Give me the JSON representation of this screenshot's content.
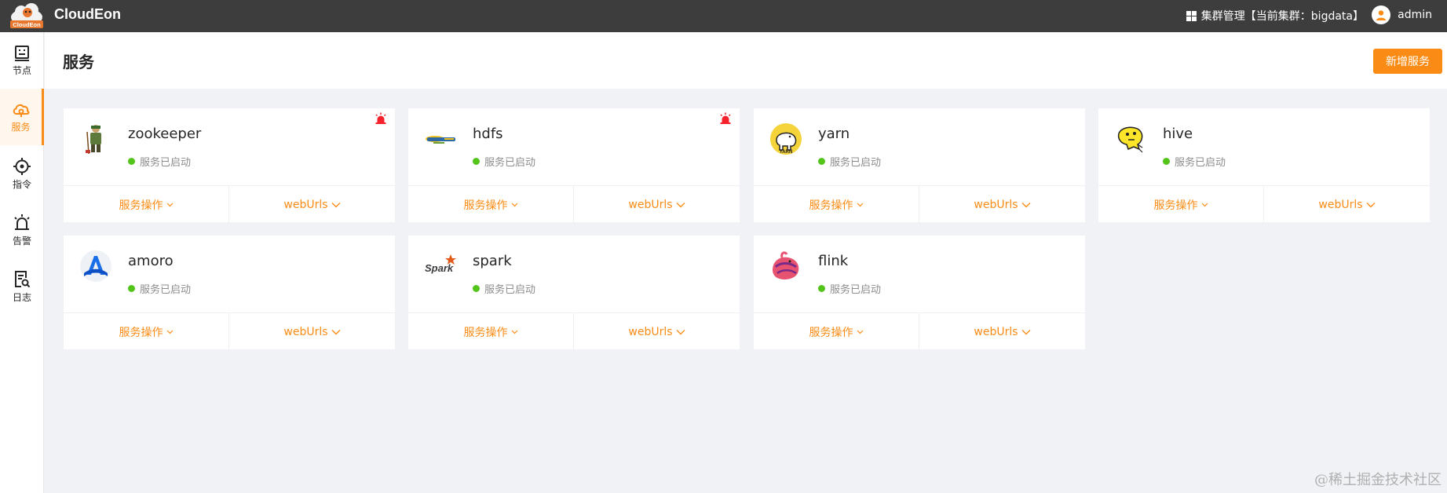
{
  "app": {
    "title": "CloudEon",
    "logo_text": "CloudEon"
  },
  "topbar": {
    "cluster_label": "集群管理【当前集群：bigdata】",
    "user_name": "admin"
  },
  "sidebar": {
    "items": [
      {
        "label": "节点",
        "icon": "node-icon",
        "active": false
      },
      {
        "label": "服务",
        "icon": "cloud-service-icon",
        "active": true
      },
      {
        "label": "指令",
        "icon": "target-icon",
        "active": false
      },
      {
        "label": "告警",
        "icon": "alarm-icon",
        "active": false
      },
      {
        "label": "日志",
        "icon": "log-icon",
        "active": false
      }
    ]
  },
  "page": {
    "title": "服务",
    "add_button": "新增服务"
  },
  "colors": {
    "accent": "#fa8c16",
    "status_ok": "#52c41a",
    "alarm": "#f5222d"
  },
  "services": [
    {
      "name": "zookeeper",
      "status": "服务已启动",
      "ops": "服务操作",
      "urls": "webUrls",
      "alarm": true,
      "icon": "zookeeper-logo-icon"
    },
    {
      "name": "hdfs",
      "status": "服务已启动",
      "ops": "服务操作",
      "urls": "webUrls",
      "alarm": true,
      "icon": "hdfs-logo-icon"
    },
    {
      "name": "yarn",
      "status": "服务已启动",
      "ops": "服务操作",
      "urls": "webUrls",
      "alarm": false,
      "icon": "yarn-logo-icon"
    },
    {
      "name": "hive",
      "status": "服务已启动",
      "ops": "服务操作",
      "urls": "webUrls",
      "alarm": false,
      "icon": "hive-logo-icon"
    },
    {
      "name": "amoro",
      "status": "服务已启动",
      "ops": "服务操作",
      "urls": "webUrls",
      "alarm": false,
      "icon": "amoro-logo-icon"
    },
    {
      "name": "spark",
      "status": "服务已启动",
      "ops": "服务操作",
      "urls": "webUrls",
      "alarm": false,
      "icon": "spark-logo-icon"
    },
    {
      "name": "flink",
      "status": "服务已启动",
      "ops": "服务操作",
      "urls": "webUrls",
      "alarm": false,
      "icon": "flink-logo-icon"
    }
  ],
  "watermark": "@稀土掘金技术社区"
}
